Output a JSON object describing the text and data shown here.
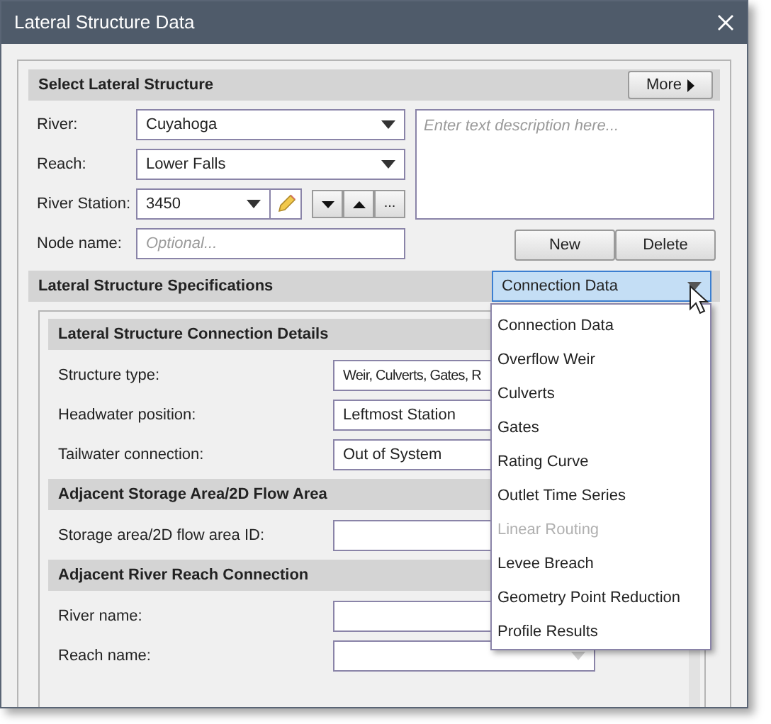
{
  "window": {
    "title": "Lateral Structure Data"
  },
  "select_section": {
    "title": "Select Lateral Structure",
    "more_button": "More",
    "river": {
      "label": "River:",
      "value": "Cuyahoga"
    },
    "reach": {
      "label": "Reach:",
      "value": "Lower Falls"
    },
    "river_station": {
      "label": "River Station:",
      "value": "3450",
      "more_button": "..."
    },
    "node_name": {
      "label": "Node name:",
      "placeholder": "Optional..."
    },
    "description": {
      "placeholder": "Enter text description here..."
    },
    "buttons": [
      "New",
      "Delete"
    ]
  },
  "specifications": {
    "title": "Lateral Structure Specifications",
    "dropdown": {
      "value": "Connection Data",
      "expanded": true,
      "options": [
        {
          "label": "Connection Data",
          "disabled": false
        },
        {
          "label": "Overflow Weir",
          "disabled": false
        },
        {
          "label": "Culverts",
          "disabled": false
        },
        {
          "label": "Gates",
          "disabled": false
        },
        {
          "label": "Rating Curve",
          "disabled": false
        },
        {
          "label": "Outlet Time Series",
          "disabled": false
        },
        {
          "label": "Linear Routing",
          "disabled": true
        },
        {
          "label": "Levee Breach",
          "disabled": false
        },
        {
          "label": "Geometry Point Reduction",
          "disabled": false
        },
        {
          "label": "Profile Results",
          "disabled": false
        }
      ]
    }
  },
  "sections": [
    {
      "title": "Lateral Structure Connection Details",
      "fields": [
        {
          "label": "Structure type:",
          "value": "Weir, Culverts, Gates, R",
          "kind": "text"
        },
        {
          "label": "Headwater position:",
          "value": "Leftmost Station",
          "kind": "text"
        },
        {
          "label": "Tailwater connection:",
          "value": "Out of System",
          "kind": "text"
        }
      ]
    },
    {
      "title": "Adjacent Storage Area/2D Flow Area",
      "fields": [
        {
          "label": "Storage area/2D flow area ID:",
          "kind": "text"
        }
      ]
    },
    {
      "title": "Adjacent River Reach Connection",
      "fields": [
        {
          "label": "River name:",
          "kind": "text"
        },
        {
          "label": "Reach name:",
          "kind": "combo"
        }
      ]
    }
  ]
}
